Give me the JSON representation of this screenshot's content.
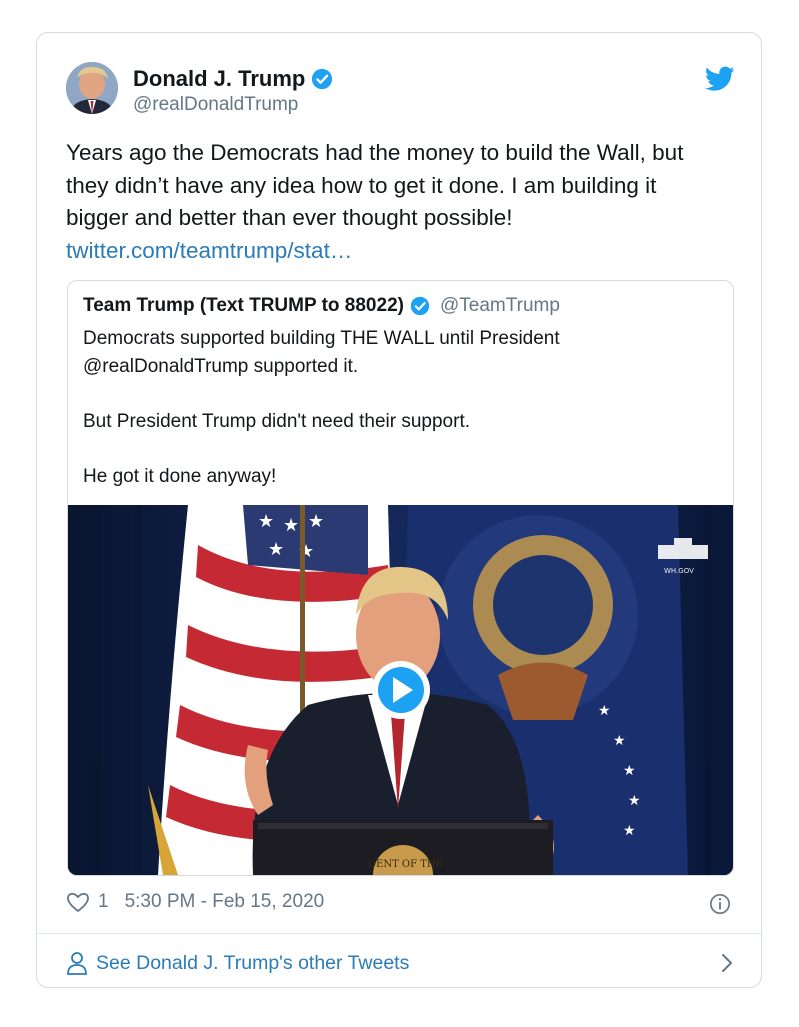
{
  "tweet": {
    "author_name": "Donald J. Trump",
    "author_handle": "@realDonaldTrump",
    "text_lines": [
      "Years ago the Democrats had the money to build the Wall, but",
      "they didn’t have any idea how to get it done. I am building it",
      "bigger and better than ever thought possible!"
    ],
    "link": "twitter.com/teamtrump/stat…",
    "likes": "1",
    "timestamp": "5:30 PM - Feb 15, 2020"
  },
  "quoted": {
    "author_name": "Team Trump (Text TRUMP to 88022)",
    "author_handle": "@TeamTrump",
    "paragraphs": [
      "Democrats supported building THE WALL until President @realDonaldTrump supported it.",
      "But President Trump didn't need their support.",
      "He got it done anyway!"
    ],
    "video_watermark": "WH.GOV",
    "seal_text": "DENT OF THE"
  },
  "footer": {
    "see_more": "See Donald J. Trump's other Tweets"
  },
  "colors": {
    "link": "#2b7bb9",
    "verified": "#1da1f2",
    "muted": "#657786",
    "border": "#d5dbe0"
  },
  "icons": [
    "twitter-bird-icon",
    "verified-icon",
    "heart-icon",
    "info-icon",
    "person-icon",
    "chevron-right-icon",
    "play-icon"
  ]
}
